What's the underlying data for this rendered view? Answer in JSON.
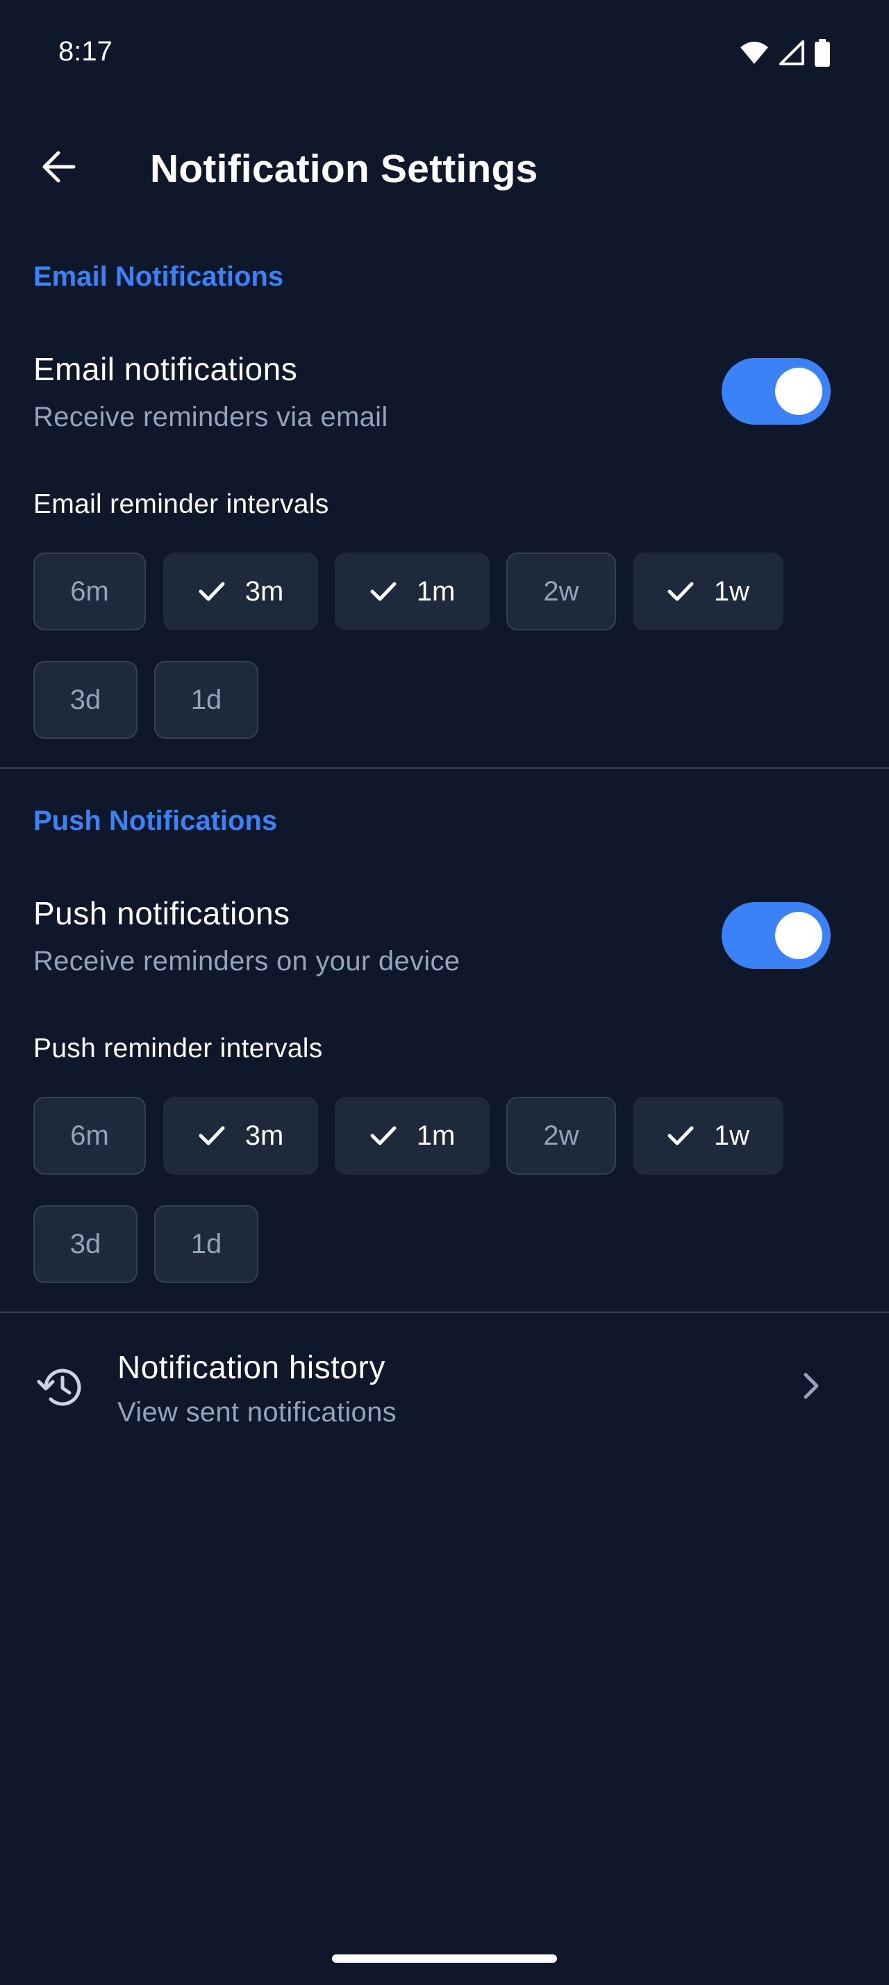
{
  "status_bar": {
    "time": "8:17",
    "icons": [
      "wifi-icon",
      "signal-icon",
      "battery-icon"
    ]
  },
  "app_bar": {
    "title": "Notification Settings",
    "back_icon": "arrow-back-icon"
  },
  "email": {
    "section_header": "Email Notifications",
    "title": "Email notifications",
    "subtitle": "Receive reminders via email",
    "enabled": true,
    "intervals_label": "Email reminder intervals",
    "intervals": [
      {
        "label": "6m",
        "selected": false
      },
      {
        "label": "3m",
        "selected": true
      },
      {
        "label": "1m",
        "selected": true
      },
      {
        "label": "2w",
        "selected": false
      },
      {
        "label": "1w",
        "selected": true
      },
      {
        "label": "3d",
        "selected": false
      },
      {
        "label": "1d",
        "selected": false
      }
    ]
  },
  "push": {
    "section_header": "Push Notifications",
    "title": "Push notifications",
    "subtitle": "Receive reminders on your device",
    "enabled": true,
    "intervals_label": "Push reminder intervals",
    "intervals": [
      {
        "label": "6m",
        "selected": false
      },
      {
        "label": "3m",
        "selected": true
      },
      {
        "label": "1m",
        "selected": true
      },
      {
        "label": "2w",
        "selected": false
      },
      {
        "label": "1w",
        "selected": true
      },
      {
        "label": "3d",
        "selected": false
      },
      {
        "label": "1d",
        "selected": false
      }
    ]
  },
  "history": {
    "title": "Notification history",
    "subtitle": "View sent notifications",
    "icon": "history-icon",
    "chevron_icon": "chevron-right-icon"
  },
  "colors": {
    "background": "#0f172a",
    "accent": "#3b82f6",
    "chip_bg": "#1e293b",
    "muted_text": "#94a3b8"
  }
}
